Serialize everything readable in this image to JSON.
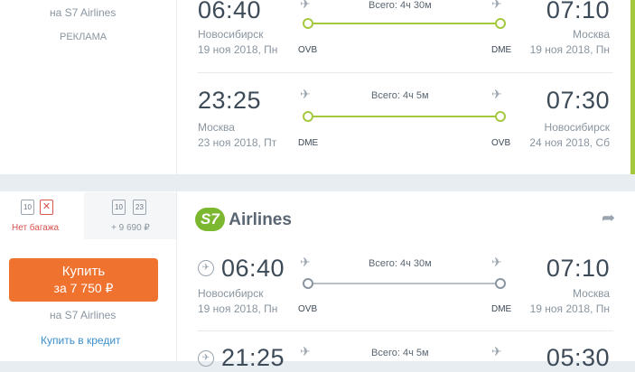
{
  "top": {
    "airline_note": "на S7 Airlines",
    "ad_label": "РЕКЛАМА",
    "segments": [
      {
        "dep_time": "06:40",
        "dep_city": "Новосибирск",
        "dep_date": "19 ноя 2018, Пн",
        "dep_code": "OVB",
        "duration": "Всего: 4ч 30м",
        "arr_time": "07:10",
        "arr_city": "Москва",
        "arr_date": "19 ноя 2018, Пн",
        "arr_code": "DME"
      },
      {
        "dep_time": "23:25",
        "dep_city": "Москва",
        "dep_date": "23 ноя 2018, Пт",
        "dep_code": "DME",
        "duration": "Всего: 4ч 5м",
        "arr_time": "07:30",
        "arr_city": "Новосибирск",
        "arr_date": "24 ноя 2018, Сб",
        "arr_code": "OVB"
      }
    ]
  },
  "bottom": {
    "baggage": {
      "none": {
        "label": "Нет багажа",
        "carry_on": "10"
      },
      "with": {
        "label": "+ 9 690 ₽",
        "carry_on": "10",
        "checked": "23"
      }
    },
    "buy_button": {
      "label": "Купить",
      "price": "за 7 750 ₽"
    },
    "airline_note": "на S7 Airlines",
    "credit_link": "Купить в кредит",
    "airline_logo": {
      "mark": "S7",
      "name": "Airlines"
    },
    "segments": [
      {
        "dep_time": "06:40",
        "dep_city": "Новосибирск",
        "dep_date": "19 ноя 2018, Пн",
        "dep_code": "OVB",
        "duration": "Всего: 4ч 30м",
        "arr_time": "07:10",
        "arr_city": "Москва",
        "arr_date": "19 ноя 2018, Пн",
        "arr_code": "DME"
      },
      {
        "dep_time": "21:25",
        "duration": "Всего: 4ч 5м",
        "arr_time": "05:30"
      }
    ]
  },
  "colors": {
    "accent_green": "#a5c93e",
    "buy_orange": "#f0722f",
    "link_blue": "#3b8ec9",
    "logo_green": "#7cb82f"
  },
  "icons": [
    "plane-takeoff-icon",
    "plane-landing-icon",
    "share-icon",
    "pin-icon",
    "baggage-icon",
    "no-baggage-icon"
  ]
}
